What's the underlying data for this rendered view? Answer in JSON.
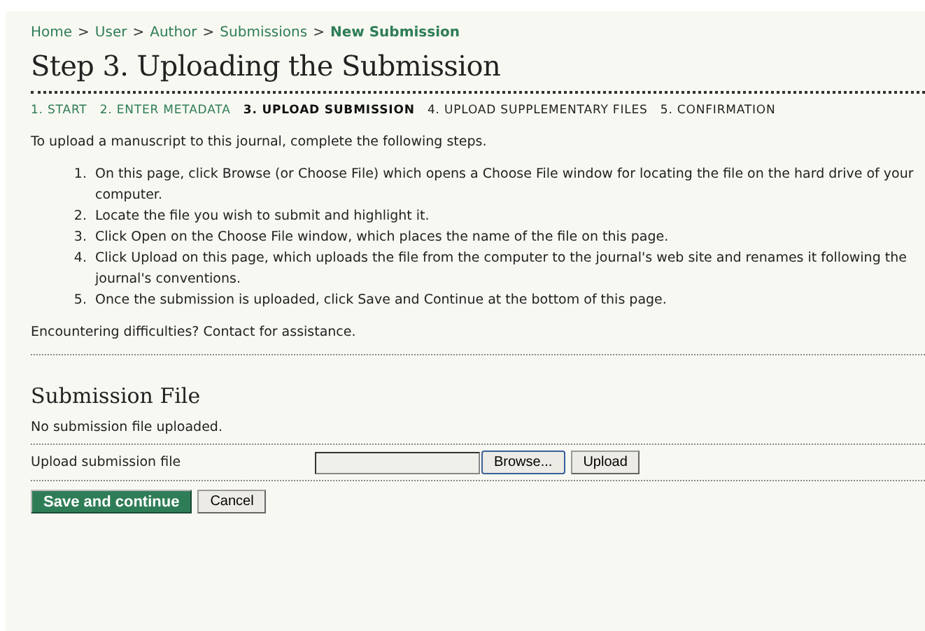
{
  "breadcrumbs": [
    {
      "label": "Home",
      "current": false
    },
    {
      "label": "User",
      "current": false
    },
    {
      "label": "Author",
      "current": false
    },
    {
      "label": "Submissions",
      "current": false
    },
    {
      "label": "New Submission",
      "current": true
    }
  ],
  "breadcrumb_separator": ">",
  "title": "Step 3. Uploading the Submission",
  "steps": [
    {
      "label": "1. START",
      "kind": "link"
    },
    {
      "label": "2. ENTER METADATA",
      "kind": "link"
    },
    {
      "label": "3. UPLOAD SUBMISSION",
      "kind": "current"
    },
    {
      "label": "4. UPLOAD SUPPLEMENTARY FILES",
      "kind": "pending"
    },
    {
      "label": "5. CONFIRMATION",
      "kind": "pending"
    }
  ],
  "intro": "To upload a manuscript to this journal, complete the following steps.",
  "instructions": [
    {
      "number": "1.",
      "text": "On this page, click Browse (or Choose File) which opens a Choose File window for locating the file on the hard drive of your computer."
    },
    {
      "number": "2.",
      "text": "Locate the file you wish to submit and highlight it."
    },
    {
      "number": "3.",
      "text": "Click Open on the Choose File window, which places the name of the file on this page."
    },
    {
      "number": "4.",
      "text": "Click Upload on this page, which uploads the file from the computer to the journal's web site and renames it following the journal's conventions."
    },
    {
      "number": "5.",
      "text": "Once the submission is uploaded, click Save and Continue at the bottom of this page."
    }
  ],
  "help": "Encountering difficulties? Contact for assistance.",
  "section_title": "Submission File",
  "status": "No submission file uploaded.",
  "upload_label": "Upload submission file",
  "browse_button": "Browse...",
  "upload_button": "Upload",
  "save_button": "Save and continue",
  "cancel_button": "Cancel"
}
